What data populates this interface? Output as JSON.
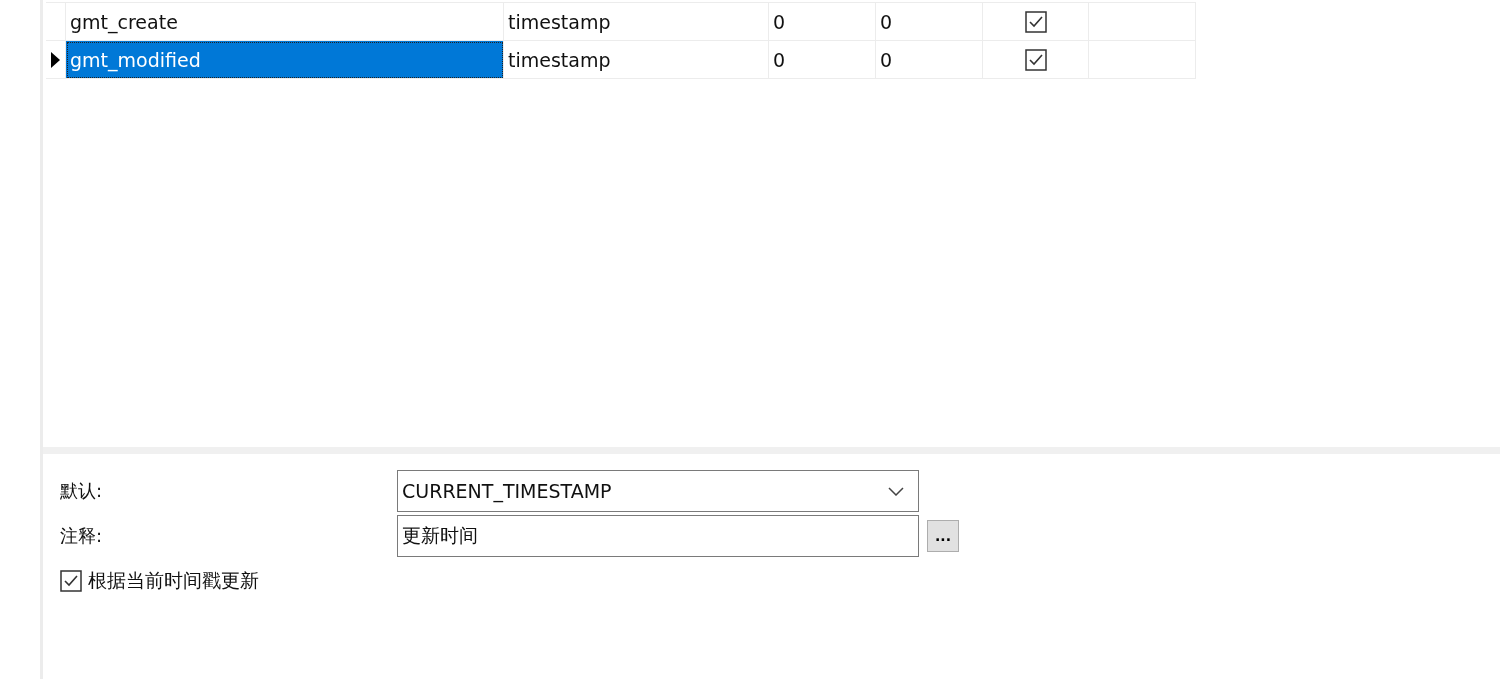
{
  "table": {
    "rows": [
      {
        "name": "gmt_create",
        "type": "timestamp",
        "length": "0",
        "decimals": "0",
        "not_null": true,
        "selected": false
      },
      {
        "name": "gmt_modified",
        "type": "timestamp",
        "length": "0",
        "decimals": "0",
        "not_null": true,
        "selected": true
      }
    ]
  },
  "properties": {
    "default": {
      "label": "默认:",
      "value": "CURRENT_TIMESTAMP"
    },
    "comment": {
      "label": "注释:",
      "value": "更新时间",
      "button": "..."
    },
    "on_update": {
      "label": "根据当前时间戳更新",
      "checked": true
    }
  }
}
